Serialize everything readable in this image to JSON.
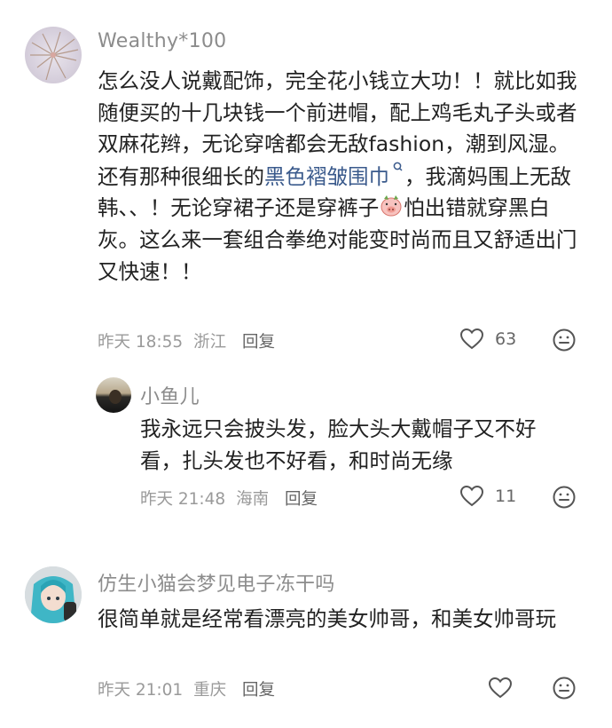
{
  "comments": [
    {
      "username": "Wealthy*100",
      "text_1": "怎么没人说戴配饰，完全花小钱立大功！！就比如我随便买的十几块钱一个前进帽，配上鸡毛丸子头或者双麻花辫，无论穿啥都会无敌fashion，潮到风湿。还有那种很细长的",
      "link": "黑色褶皱围巾",
      "text_2": "，我滴妈围上无敌韩、、！无论穿裙子还是穿裤子",
      "text_3": "怕出错就穿黑白灰。这么来一套组合拳绝对能变时尚而且又舒适出门又快速！！",
      "date": "昨天 18:55",
      "location": "浙江",
      "reply_label": "回复",
      "likes": "63"
    },
    {
      "username": "小鱼儿",
      "text": "我永远只会披头发，脸大头大戴帽子又不好看，扎头发也不好看，和时尚无缘",
      "date": "昨天 21:48",
      "location": "海南",
      "reply_label": "回复",
      "likes": "11"
    },
    {
      "username": "仿生小猫会梦见电子冻干吗",
      "text": "很简单就是经常看漂亮的美女帅哥，和美女帅哥玩",
      "date": "昨天 21:01",
      "location": "重庆",
      "reply_label": "回复",
      "likes": ""
    }
  ],
  "icons": {
    "like": "heart-outline-icon",
    "emoji": "smiley-reply-icon",
    "search_hint": "search-small-icon",
    "inline_emoji": "pig-head-emoji"
  },
  "colors": {
    "link": "#3a5a8c",
    "meta": "#9a9a9a",
    "username": "#8c8c8c"
  }
}
